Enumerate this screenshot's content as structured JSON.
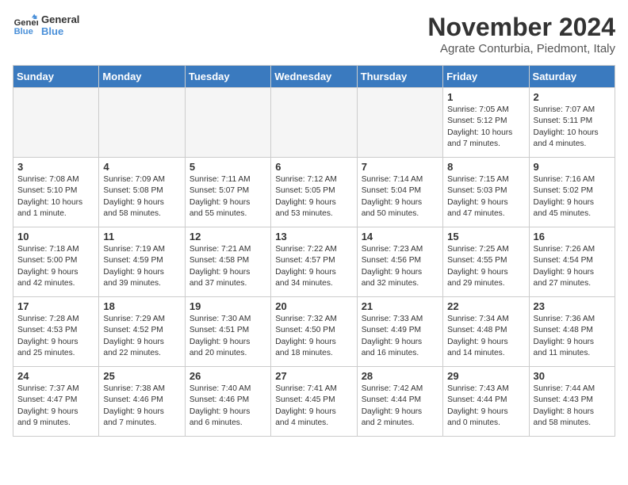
{
  "header": {
    "logo_line1": "General",
    "logo_line2": "Blue",
    "month_title": "November 2024",
    "location": "Agrate Conturbia, Piedmont, Italy"
  },
  "days_of_week": [
    "Sunday",
    "Monday",
    "Tuesday",
    "Wednesday",
    "Thursday",
    "Friday",
    "Saturday"
  ],
  "weeks": [
    [
      {
        "day": "",
        "info": ""
      },
      {
        "day": "",
        "info": ""
      },
      {
        "day": "",
        "info": ""
      },
      {
        "day": "",
        "info": ""
      },
      {
        "day": "",
        "info": ""
      },
      {
        "day": "1",
        "info": "Sunrise: 7:05 AM\nSunset: 5:12 PM\nDaylight: 10 hours\nand 7 minutes."
      },
      {
        "day": "2",
        "info": "Sunrise: 7:07 AM\nSunset: 5:11 PM\nDaylight: 10 hours\nand 4 minutes."
      }
    ],
    [
      {
        "day": "3",
        "info": "Sunrise: 7:08 AM\nSunset: 5:10 PM\nDaylight: 10 hours\nand 1 minute."
      },
      {
        "day": "4",
        "info": "Sunrise: 7:09 AM\nSunset: 5:08 PM\nDaylight: 9 hours\nand 58 minutes."
      },
      {
        "day": "5",
        "info": "Sunrise: 7:11 AM\nSunset: 5:07 PM\nDaylight: 9 hours\nand 55 minutes."
      },
      {
        "day": "6",
        "info": "Sunrise: 7:12 AM\nSunset: 5:05 PM\nDaylight: 9 hours\nand 53 minutes."
      },
      {
        "day": "7",
        "info": "Sunrise: 7:14 AM\nSunset: 5:04 PM\nDaylight: 9 hours\nand 50 minutes."
      },
      {
        "day": "8",
        "info": "Sunrise: 7:15 AM\nSunset: 5:03 PM\nDaylight: 9 hours\nand 47 minutes."
      },
      {
        "day": "9",
        "info": "Sunrise: 7:16 AM\nSunset: 5:02 PM\nDaylight: 9 hours\nand 45 minutes."
      }
    ],
    [
      {
        "day": "10",
        "info": "Sunrise: 7:18 AM\nSunset: 5:00 PM\nDaylight: 9 hours\nand 42 minutes."
      },
      {
        "day": "11",
        "info": "Sunrise: 7:19 AM\nSunset: 4:59 PM\nDaylight: 9 hours\nand 39 minutes."
      },
      {
        "day": "12",
        "info": "Sunrise: 7:21 AM\nSunset: 4:58 PM\nDaylight: 9 hours\nand 37 minutes."
      },
      {
        "day": "13",
        "info": "Sunrise: 7:22 AM\nSunset: 4:57 PM\nDaylight: 9 hours\nand 34 minutes."
      },
      {
        "day": "14",
        "info": "Sunrise: 7:23 AM\nSunset: 4:56 PM\nDaylight: 9 hours\nand 32 minutes."
      },
      {
        "day": "15",
        "info": "Sunrise: 7:25 AM\nSunset: 4:55 PM\nDaylight: 9 hours\nand 29 minutes."
      },
      {
        "day": "16",
        "info": "Sunrise: 7:26 AM\nSunset: 4:54 PM\nDaylight: 9 hours\nand 27 minutes."
      }
    ],
    [
      {
        "day": "17",
        "info": "Sunrise: 7:28 AM\nSunset: 4:53 PM\nDaylight: 9 hours\nand 25 minutes."
      },
      {
        "day": "18",
        "info": "Sunrise: 7:29 AM\nSunset: 4:52 PM\nDaylight: 9 hours\nand 22 minutes."
      },
      {
        "day": "19",
        "info": "Sunrise: 7:30 AM\nSunset: 4:51 PM\nDaylight: 9 hours\nand 20 minutes."
      },
      {
        "day": "20",
        "info": "Sunrise: 7:32 AM\nSunset: 4:50 PM\nDaylight: 9 hours\nand 18 minutes."
      },
      {
        "day": "21",
        "info": "Sunrise: 7:33 AM\nSunset: 4:49 PM\nDaylight: 9 hours\nand 16 minutes."
      },
      {
        "day": "22",
        "info": "Sunrise: 7:34 AM\nSunset: 4:48 PM\nDaylight: 9 hours\nand 14 minutes."
      },
      {
        "day": "23",
        "info": "Sunrise: 7:36 AM\nSunset: 4:48 PM\nDaylight: 9 hours\nand 11 minutes."
      }
    ],
    [
      {
        "day": "24",
        "info": "Sunrise: 7:37 AM\nSunset: 4:47 PM\nDaylight: 9 hours\nand 9 minutes."
      },
      {
        "day": "25",
        "info": "Sunrise: 7:38 AM\nSunset: 4:46 PM\nDaylight: 9 hours\nand 7 minutes."
      },
      {
        "day": "26",
        "info": "Sunrise: 7:40 AM\nSunset: 4:46 PM\nDaylight: 9 hours\nand 6 minutes."
      },
      {
        "day": "27",
        "info": "Sunrise: 7:41 AM\nSunset: 4:45 PM\nDaylight: 9 hours\nand 4 minutes."
      },
      {
        "day": "28",
        "info": "Sunrise: 7:42 AM\nSunset: 4:44 PM\nDaylight: 9 hours\nand 2 minutes."
      },
      {
        "day": "29",
        "info": "Sunrise: 7:43 AM\nSunset: 4:44 PM\nDaylight: 9 hours\nand 0 minutes."
      },
      {
        "day": "30",
        "info": "Sunrise: 7:44 AM\nSunset: 4:43 PM\nDaylight: 8 hours\nand 58 minutes."
      }
    ]
  ]
}
